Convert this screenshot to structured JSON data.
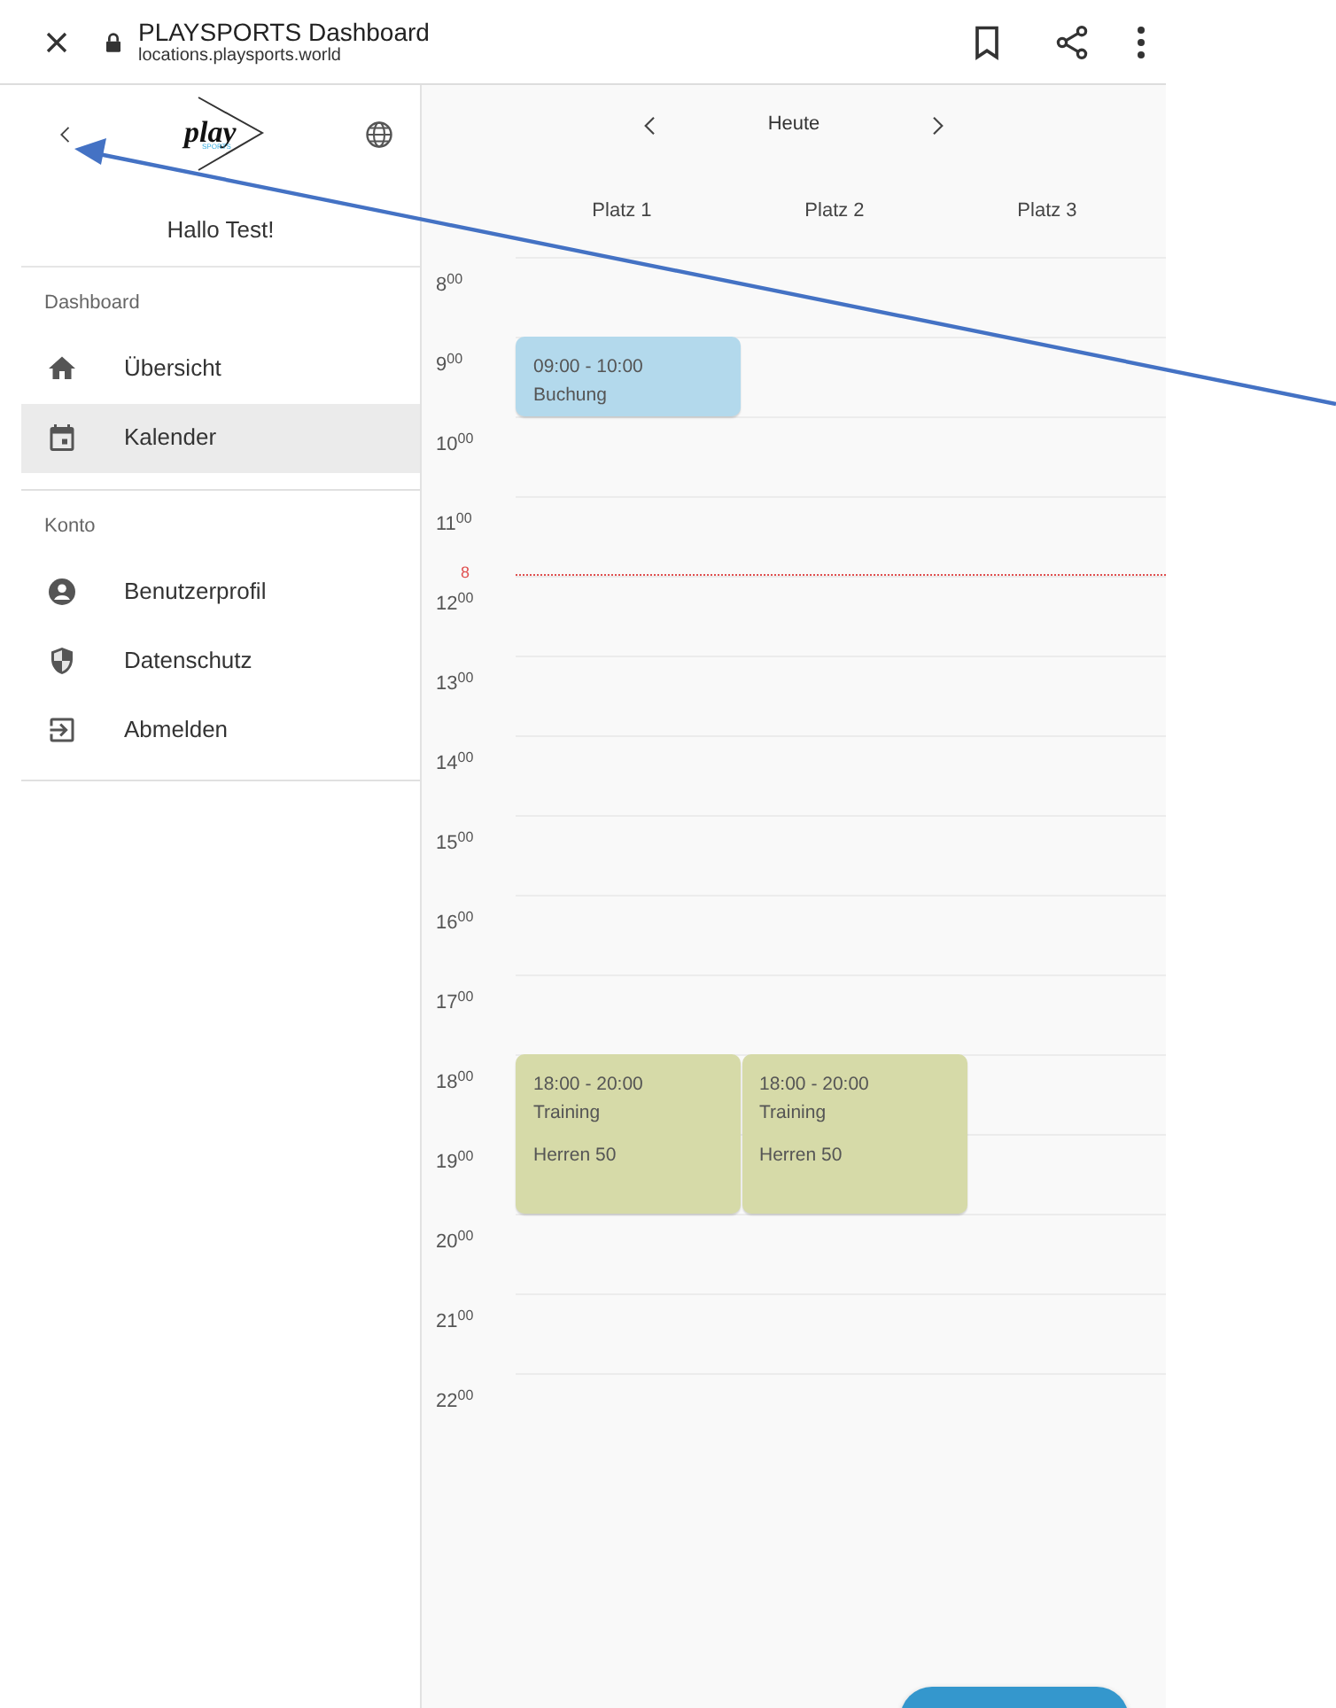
{
  "browser": {
    "title": "PLAYSPORTS Dashboard",
    "url": "locations.playsports.world"
  },
  "sidebar": {
    "logo": {
      "text": "play",
      "subtext": "SPORTS"
    },
    "greeting": "Hallo Test!",
    "sections": [
      {
        "heading": "Dashboard",
        "items": [
          {
            "label": "Übersicht",
            "selected": false
          },
          {
            "label": "Kalender",
            "selected": true
          }
        ]
      },
      {
        "heading": "Konto",
        "items": [
          {
            "label": "Benutzerprofil",
            "selected": false
          },
          {
            "label": "Datenschutz",
            "selected": false
          },
          {
            "label": "Abmelden",
            "selected": false
          }
        ]
      }
    ]
  },
  "calendar": {
    "today_button": "Heute",
    "now_marker": "8",
    "hours": [
      "8$^{00}$",
      "9$^{00}$",
      "10$^{00}$",
      "11$^{00}$",
      "12$^{00}$",
      "13$^{00}$",
      "14$^{00}$",
      "15$^{00}$",
      "16$^{00}$",
      "17$^{00}$",
      "18$^{00}$",
      "19$^{00}$",
      "20$^{00}$",
      "21$^{00}$",
      "22$^{00}$"
    ],
    "columns": [
      {
        "label": "Platz 1",
        "events": [
          {
            "time": "09:00 - 10:00",
            "title": "Buchung",
            "color": "#b3d9ec"
          },
          {
            "time": "18:00 - 20:00",
            "title": "Training",
            "note": "Herren 50",
            "color": "#d6daa8"
          }
        ]
      },
      {
        "label": "Platz 2",
        "events": [
          {
            "time": "18:00 - 20:00",
            "title": "Training",
            "note": "Herren 50",
            "color": "#d6daa8"
          }
        ]
      },
      {
        "label": "Platz 3"
      }
    ]
  }
}
